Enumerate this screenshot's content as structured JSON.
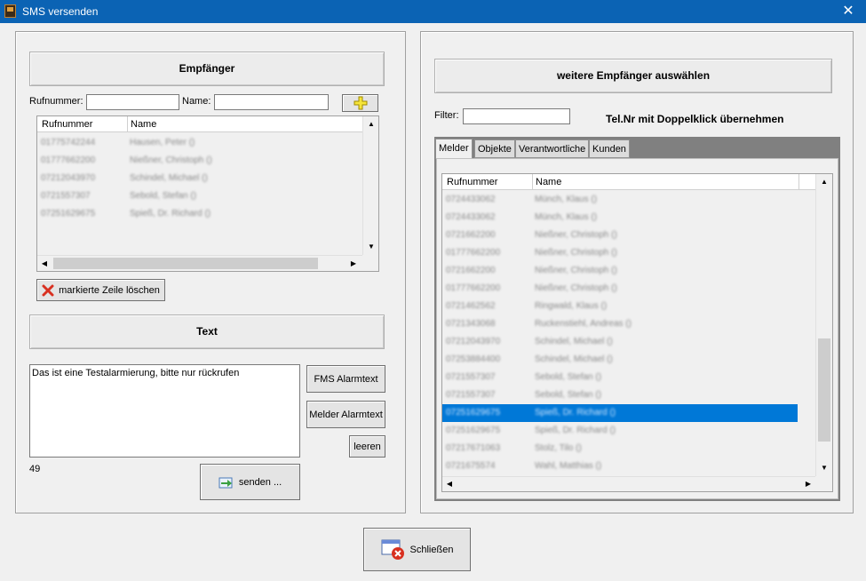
{
  "window": {
    "title": "SMS versenden",
    "close_glyph": "✕"
  },
  "left": {
    "recipients_header": "Empfänger",
    "phone_label": "Rufnummer:",
    "name_label": "Name:",
    "phone_value": "",
    "name_value": "",
    "columns": [
      "Rufnummer",
      "Name"
    ],
    "rows": [
      [
        "01775742244",
        "Hausen, Peter ()"
      ],
      [
        "01777662200",
        "Nießner, Christoph ()"
      ],
      [
        "07212043970",
        "Schindel, Michael ()"
      ],
      [
        "0721557307",
        "Sebold, Stefan ()"
      ],
      [
        "07251629675",
        "Spieß, Dr. Richard ()"
      ]
    ],
    "delete_button": "markierte Zeile löschen",
    "text_header": "Text",
    "message": "Das ist eine Testalarmierung, bitte nur rückrufen",
    "char_count": "49",
    "fms_button": "FMS Alarmtext",
    "melder_button": "Melder Alarmtext",
    "clear_button": "leeren",
    "send_button": "senden ..."
  },
  "right": {
    "header": "weitere Empfänger auswählen",
    "filter_label": "Filter:",
    "filter_value": "",
    "hint": "Tel.Nr mit Doppelklick übernehmen",
    "tabs": [
      "Melder",
      "Objekte",
      "Verantwortliche",
      "Kunden"
    ],
    "columns": [
      "Rufnummer",
      "Name"
    ],
    "rows": [
      [
        "0724433062",
        "Münch, Klaus ()"
      ],
      [
        "0724433062",
        "Münch, Klaus ()"
      ],
      [
        "0721662200",
        "Nießner, Christoph ()"
      ],
      [
        "01777662200",
        "Nießner, Christoph ()"
      ],
      [
        "0721662200",
        "Nießner, Christoph ()"
      ],
      [
        "01777662200",
        "Nießner, Christoph ()"
      ],
      [
        "0721462562",
        "Ringwald, Klaus ()"
      ],
      [
        "0721343068",
        "Ruckenstiehl, Andreas ()"
      ],
      [
        "07212043970",
        "Schindel, Michael ()"
      ],
      [
        "07253884400",
        "Schindel, Michael ()"
      ],
      [
        "0721557307",
        "Sebold, Stefan ()"
      ],
      [
        "0721557307",
        "Sebold, Stefan ()"
      ],
      [
        "07251629675",
        "Spieß, Dr. Richard ()"
      ],
      [
        "07251629675",
        "Spieß, Dr. Richard ()"
      ],
      [
        "07217671063",
        "Stolz, Tilo ()"
      ],
      [
        "0721675574",
        "Wahl, Matthias ()"
      ]
    ],
    "selected_row": 12
  },
  "footer": {
    "close_button": "Schließen"
  }
}
